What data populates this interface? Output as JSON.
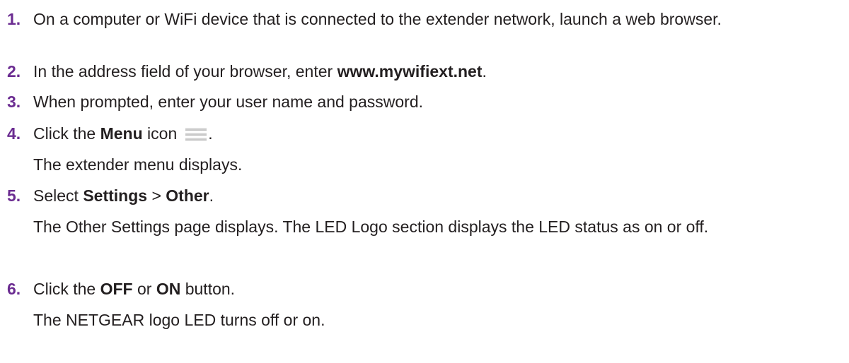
{
  "steps": [
    {
      "num": "1.",
      "text": "On a computer or WiFi device that is connected to the extender network, launch a web browser."
    },
    {
      "num": "2.",
      "pre": "In the address field of your browser, enter ",
      "bold": "www.mywifiext.net",
      "post": "."
    },
    {
      "num": "3.",
      "text": "When prompted, enter your user name and password."
    },
    {
      "num": "4.",
      "pre": "Click the ",
      "bold": "Menu",
      "post": " icon",
      "end": ".",
      "icon": "menu-icon",
      "sub": "The extender menu displays."
    },
    {
      "num": "5.",
      "pre": "Select ",
      "bold": "Settings",
      "mid": " > ",
      "bold2": "Other",
      "post": ".",
      "sub": "The Other Settings page displays. The LED Logo section displays the LED status as on or off."
    },
    {
      "num": "6.",
      "pre": "Click the ",
      "bold": "OFF",
      "mid": " or ",
      "bold2": "ON",
      "post": " button.",
      "sub": "The NETGEAR logo LED turns off or on."
    }
  ],
  "colors": {
    "number": "#6b2c91",
    "text": "#231f20"
  }
}
